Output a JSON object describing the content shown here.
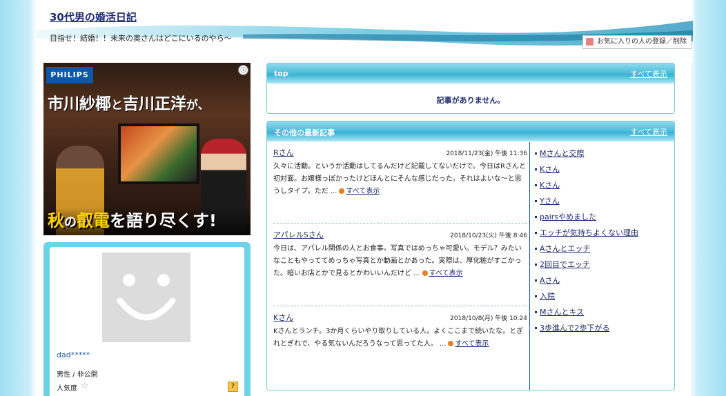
{
  "header": {
    "blog_title": "30代男の婚活日記",
    "subtitle": "目指せ！結婚！！未来の奥さんはどこにいるのやら～",
    "fav_button": "お気に入りの人の登録／削除"
  },
  "ad": {
    "brand": "PHILIPS",
    "headline_a": "市川紗椰",
    "headline_b": "と",
    "headline_c": "吉川正洋",
    "headline_d": "が、",
    "tagline_a": "秋",
    "tagline_b": "の",
    "tagline_c": "叡電",
    "tagline_d": "を語り尽くす!",
    "adchoice": "ⓘ"
  },
  "profile": {
    "username": "dad*****",
    "gender": "男性 / 非公開",
    "popularity_label": "人気度",
    "help": "?"
  },
  "top_box": {
    "title": "top",
    "view_all": "すべて表示",
    "empty_message": "記事がありません。"
  },
  "latest_box": {
    "title": "その他の最新記事",
    "view_all": "すべて表示",
    "articles": [
      {
        "title": "Rさん",
        "date": "2018/11/23(金) 午後 11:36",
        "body": "久々に活動。というか活動はしてるんだけど記載してないだけで。今日はRさんと初対面。お嬢様っぽかったけどほんとにそんな感じだった。それはよいな～と思うしタイプ。ただ ...",
        "more": "すべて表示"
      },
      {
        "title": "アパレルSさん",
        "date": "2018/10/23(火) 午後 8:46",
        "body": "今日は、アパレル関係の人とお食事。写真ではめっちゃ可愛い。モデル？みたいなこともやっててめっちゃ写真とか動画とかあった。実際は、厚化粧がすごかった。暗いお店とかで見るとかわいいんだけど ...",
        "more": "すべて表示"
      },
      {
        "title": "Kさん",
        "date": "2018/10/8(月) 午後 10:24",
        "body": "Kさんとランチ。3か月くらいやり取りしている人。よくここまで続いたな。とぎれとぎれで、やる気ないんだろうなって思ってた人。 ...",
        "more": "すべて表示"
      }
    ],
    "side_links": [
      "Mさんと交際",
      "Kさん",
      "Kさん",
      "Yさん",
      "pairsやめました",
      "エッチが気持ちよくない理由",
      "Aさんとエッチ",
      "2回目でエッチ",
      "Aさん",
      "入院",
      "Mさんとキス",
      "3歩進んで2歩下がる"
    ]
  },
  "colors": {
    "accent": "#38b2d4",
    "link": "#1d2a6b",
    "profile_border": "#6fd3e6"
  }
}
